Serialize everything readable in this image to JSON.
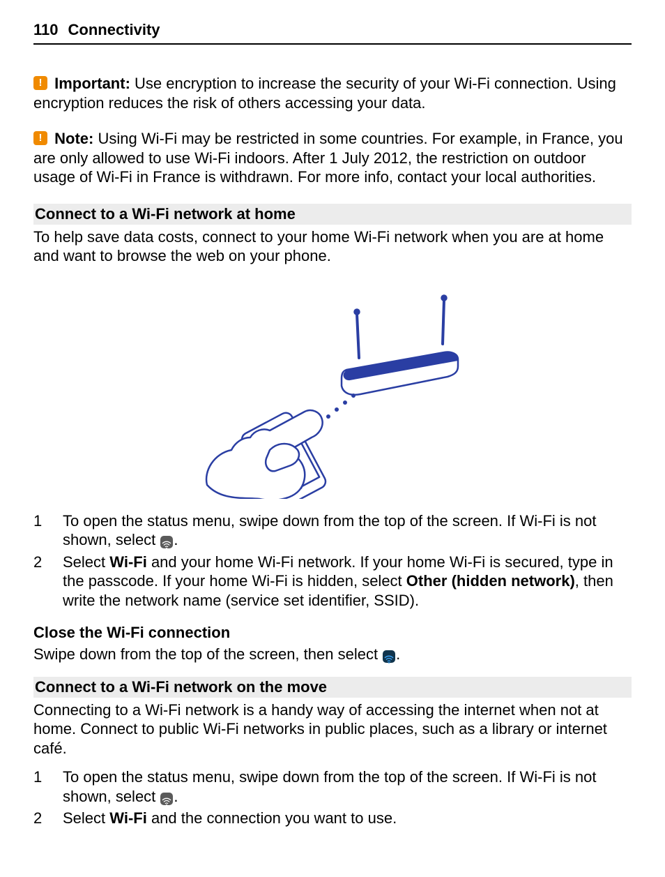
{
  "header": {
    "page_number": "110",
    "title": "Connectivity"
  },
  "callouts": {
    "important": {
      "label": "Important:",
      "text": " Use encryption to increase the security of your Wi-Fi connection. Using encryption reduces the risk of others accessing your data."
    },
    "note": {
      "label": "Note:",
      "text": " Using Wi-Fi may be restricted in some countries. For example, in France, you are only allowed to use Wi-Fi indoors. After 1 July 2012, the restriction on outdoor usage of Wi-Fi in France is withdrawn. For more info, contact your local authorities."
    }
  },
  "section_home": {
    "heading": "Connect to a Wi-Fi network at home",
    "intro": "To help save data costs, connect to your home Wi-Fi network when you are at home and want to browse the web on your phone.",
    "steps": {
      "s1a": "To open the status menu, swipe down from the top of the screen. If Wi-Fi is not shown, select ",
      "s1b": ".",
      "s2a": "Select ",
      "s2_wifi": "Wi-Fi",
      "s2b": " and your home Wi-Fi network. If your home Wi-Fi is secured, type in the passcode. If your home Wi-Fi is hidden, select ",
      "s2_other": "Other (hidden network)",
      "s2c": ", then write the network name (service set identifier, SSID)."
    }
  },
  "section_close": {
    "heading": "Close the Wi-Fi connection",
    "text_a": "Swipe down from the top of the screen, then select ",
    "text_b": "."
  },
  "section_move": {
    "heading": "Connect to a Wi-Fi network on the move",
    "intro": "Connecting to a Wi-Fi network is a handy way of accessing the internet when not at home. Connect to public Wi-Fi networks in public places, such as a library or internet café.",
    "steps": {
      "s1a": "To open the status menu, swipe down from the top of the screen. If Wi-Fi is not shown, select ",
      "s1b": ".",
      "s2a": "Select ",
      "s2_wifi": "Wi-Fi",
      "s2b": " and the connection you want to use."
    }
  }
}
